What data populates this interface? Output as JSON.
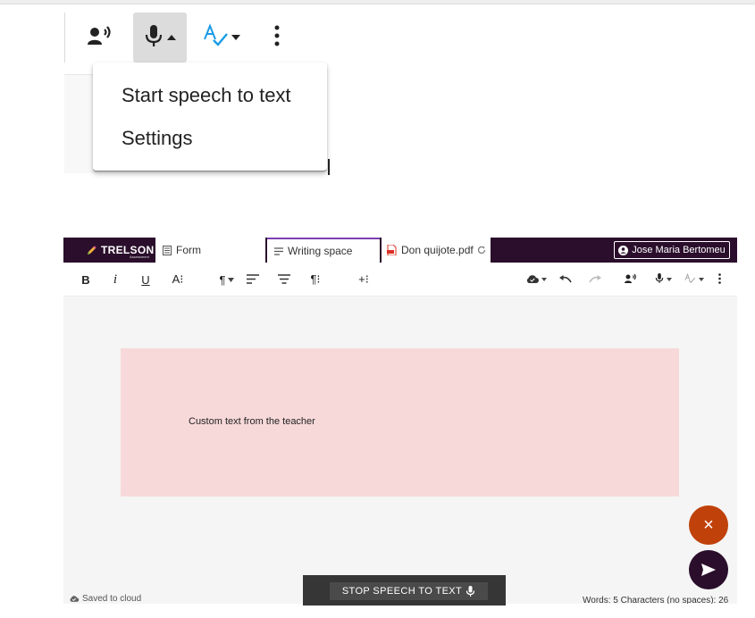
{
  "dropdown": {
    "items": [
      {
        "label": "Start speech to text"
      },
      {
        "label": "Settings"
      }
    ]
  },
  "zoom_toolbar": {
    "icons": [
      "text-to-speech-icon",
      "microphone-icon",
      "caret-up-icon",
      "spellcheck-icon",
      "caret-down-icon",
      "more-vert-icon"
    ]
  },
  "header": {
    "logo_text": "TRELSON",
    "logo_sub": "Assessment",
    "tabs": [
      {
        "label": "Form",
        "icon": "form-icon"
      },
      {
        "label": "Writing space",
        "icon": "document-lines-icon",
        "active": true
      },
      {
        "label": "Don quijote.pdf",
        "icon": "pdf-icon"
      }
    ],
    "user_name": "Jose Maria Bertomeu"
  },
  "toolbar": {
    "bold": "B",
    "italic": "i",
    "underline": "U",
    "textsize": "A⁝",
    "para": "¶",
    "paraspace": "¶⁝",
    "insert": "+⁝"
  },
  "content": {
    "note_text": "Custom text from the teacher"
  },
  "fabs": {
    "close": "×"
  },
  "status": {
    "saved": "Saved to cloud",
    "counts": "Words: 5  Characters (no spaces): 26"
  },
  "speech_bar": {
    "stop_label": "STOP SPEECH TO TEXT"
  },
  "colors": {
    "header_bg": "#2a0e2b",
    "active_tab_accent": "#7b3fb0",
    "note_bg": "#f8d9d9",
    "fab_close": "#c0410a",
    "fab_send": "#2a0e2b",
    "spellcheck_blue": "#1a9be6",
    "speech_bar_bg": "#363636"
  }
}
